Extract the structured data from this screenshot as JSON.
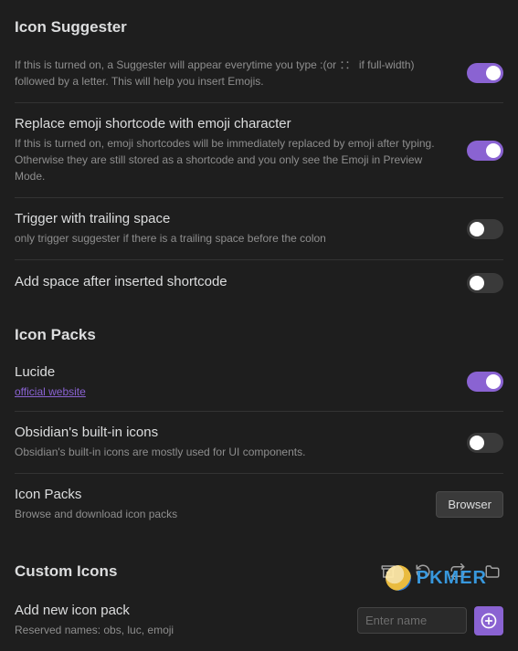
{
  "sections": {
    "iconSuggester": {
      "heading": "Icon Suggester",
      "items": [
        {
          "desc": "If this is turned on, a Suggester will appear everytime you type :(or ：： if full-width) followed by a letter. This will help you insert Emojis.",
          "on": true
        },
        {
          "name": "Replace emoji shortcode with emoji character",
          "desc": "If this is turned on, emoji shortcodes will be immediately replaced by emoji after typing. Otherwise they are still stored as a shortcode and you only see the Emoji in Preview Mode.",
          "on": true
        },
        {
          "name": "Trigger with trailing space",
          "desc": "only trigger suggester if there is a trailing space before the colon",
          "on": false
        },
        {
          "name": "Add space after inserted shortcode",
          "on": false
        }
      ]
    },
    "iconPacks": {
      "heading": "Icon Packs",
      "items": [
        {
          "name": "Lucide",
          "link": "official website",
          "on": true
        },
        {
          "name": "Obsidian's built-in icons",
          "desc": "Obsidian's built-in icons are mostly used for UI components.",
          "on": false
        },
        {
          "name": "Icon Packs",
          "desc": "Browse and download icon packs",
          "button": "Browser"
        }
      ]
    },
    "customIcons": {
      "heading": "Custom Icons",
      "addNew": {
        "name": "Add new icon pack",
        "desc": "Reserved names: obs, luc, emoji",
        "placeholder": "Enter name"
      }
    }
  },
  "watermark": "PKMER"
}
